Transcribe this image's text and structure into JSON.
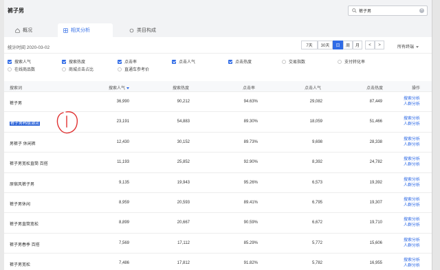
{
  "header": {
    "title": "裤子男"
  },
  "search": {
    "value": "裤子男"
  },
  "tabs": [
    {
      "label": "概况"
    },
    {
      "label": "相关分析"
    },
    {
      "label": "类目构成"
    }
  ],
  "stats": {
    "date_label": "统计时间 2020-03-02",
    "ranges": [
      "7天",
      "30天",
      "日",
      "周",
      "月"
    ],
    "active_range": "日",
    "prev": "<",
    "next": ">",
    "terminal": "所有终端"
  },
  "metrics": [
    {
      "label": "搜索人气",
      "checked": true
    },
    {
      "label": "搜索热度",
      "checked": true
    },
    {
      "label": "点击率",
      "checked": true
    },
    {
      "label": "点击人气",
      "checked": true
    },
    {
      "label": "点击热度",
      "checked": true
    },
    {
      "label": "交易指数",
      "checked": false
    },
    {
      "label": "支付转化率",
      "checked": false
    },
    {
      "label": "在线商品数",
      "checked": false
    },
    {
      "label": "商城点击占比",
      "checked": false
    },
    {
      "label": "直通车参考价",
      "checked": false
    }
  ],
  "table": {
    "columns": [
      "搜索词",
      "搜索人气",
      "搜索热度",
      "点击率",
      "点击人气",
      "点击热度",
      "操作"
    ],
    "rows": [
      {
        "term": "裤子男",
        "search_pop": "36,990",
        "search_heat": "90,212",
        "ctr": "94.63%",
        "click_pop": "29,082",
        "click_heat": "87,449"
      },
      {
        "term": "裤子男韩版潮流",
        "search_pop": "23,191",
        "search_heat": "54,883",
        "ctr": "89.30%",
        "click_pop": "18,059",
        "click_heat": "51,466"
      },
      {
        "term": "男裤子 休闲裤",
        "search_pop": "12,430",
        "search_heat": "30,152",
        "ctr": "89.73%",
        "click_pop": "9,698",
        "click_heat": "28,338"
      },
      {
        "term": "裤子男宽松直筒 百搭",
        "search_pop": "11,193",
        "search_heat": "25,852",
        "ctr": "92.90%",
        "click_pop": "8,392",
        "click_heat": "24,782"
      },
      {
        "term": "原宿风裤子男",
        "search_pop": "9,135",
        "search_heat": "19,943",
        "ctr": "95.26%",
        "click_pop": "6,573",
        "click_heat": "19,392"
      },
      {
        "term": "裤子男休闲",
        "search_pop": "8,959",
        "search_heat": "20,593",
        "ctr": "89.41%",
        "click_pop": "6,795",
        "click_heat": "19,307"
      },
      {
        "term": "裤子男直筒宽松",
        "search_pop": "8,899",
        "search_heat": "20,667",
        "ctr": "90.59%",
        "click_pop": "6,672",
        "click_heat": "19,710"
      },
      {
        "term": "裤子男春季 百搭",
        "search_pop": "7,569",
        "search_heat": "17,112",
        "ctr": "85.29%",
        "click_pop": "5,772",
        "click_heat": "15,606"
      },
      {
        "term": "裤子男宽松",
        "search_pop": "7,486",
        "search_heat": "17,812",
        "ctr": "91.82%",
        "click_pop": "5,782",
        "click_heat": "16,955"
      }
    ],
    "op_search": "搜索分析",
    "op_people": "人群分析"
  },
  "colors": {
    "accent": "#2f6be6",
    "annotation": "#e03030"
  }
}
